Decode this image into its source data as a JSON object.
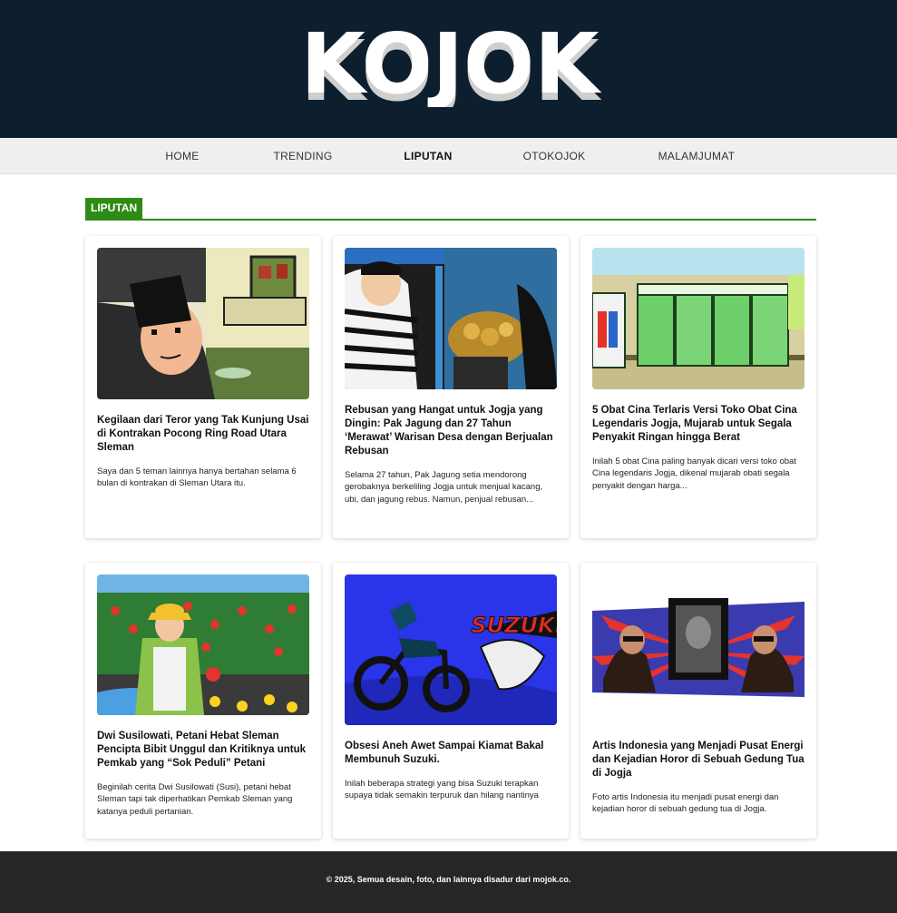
{
  "site": {
    "logo_text": "KOJOK"
  },
  "nav": {
    "items": [
      {
        "label": "HOME"
      },
      {
        "label": "TRENDING"
      },
      {
        "label": "LIPUTAN"
      },
      {
        "label": "OTOKOJOK"
      },
      {
        "label": "MALAMJUMAT"
      }
    ],
    "active": "LIPUTAN"
  },
  "section": {
    "label": "LIPUTAN",
    "accent_color": "#2e8b16"
  },
  "articles": [
    {
      "title": "Kegilaan dari Teror yang Tak Kunjung Usai di Kontrakan Pocong Ring Road Utara Sleman",
      "excerpt": "Saya dan 5 teman lainnya hanya bertahan selama 6 bulan di kontrakan di Sleman Utara itu."
    },
    {
      "title": "Rebusan yang Hangat untuk Jogja yang Dingin: Pak Jagung dan 27 Tahun ‘Merawat’ Warisan Desa dengan Berjualan Rebusan",
      "excerpt": "Selama 27 tahun, Pak Jagung setia mendorong gerobaknya berkeliling Jogja untuk menjual kacang, ubi, dan jagung rebus. Namun, penjual rebusan..."
    },
    {
      "title": "5 Obat Cina Terlaris Versi Toko Obat Cina Legendaris Jogja, Mujarab untuk Segala Penyakit Ringan hingga Berat",
      "excerpt": "Inilah 5 obat Cina paling banyak dicari versi toko obat Cina legendaris Jogja, dikenal mujarab obati segala penyakit dengan harga..."
    },
    {
      "title": "Dwi Susilowati, Petani Hebat Sleman Pencipta Bibit Unggul dan Kritiknya untuk Pemkab yang “Sok Peduli” Petani",
      "excerpt": "Beginilah cerita Dwi Susilowati (Susi), petani hebat Sleman tapi tak diperhatikan Pemkab Sleman yang katanya peduli pertanian."
    },
    {
      "title": "Obsesi Aneh Awet Sampai Kiamat Bakal Membunuh Suzuki.",
      "excerpt": "Inilah beberapa strategi yang bisa Suzuki terapkan supaya tidak semakin terpuruk dan hilang nantinya",
      "image_text": "SUZUKI"
    },
    {
      "title": "Artis Indonesia yang Menjadi Pusat Energi dan Kejadian Horor di Sebuah Gedung Tua di Jogja",
      "excerpt": "Foto artis Indonesia itu menjadi pusat energi dan kejadian horor di sebuah gedung tua di Jogja."
    }
  ],
  "footer": {
    "text": "© 2025, Semua desain, foto, dan lainnya disadur dari mojok.co."
  },
  "colors": {
    "masthead": "#0d1f2f",
    "nav_bg": "#efefef",
    "accent": "#2e8b16",
    "footer_bg": "#262626"
  },
  "icons": [
    "kojok-logo"
  ]
}
